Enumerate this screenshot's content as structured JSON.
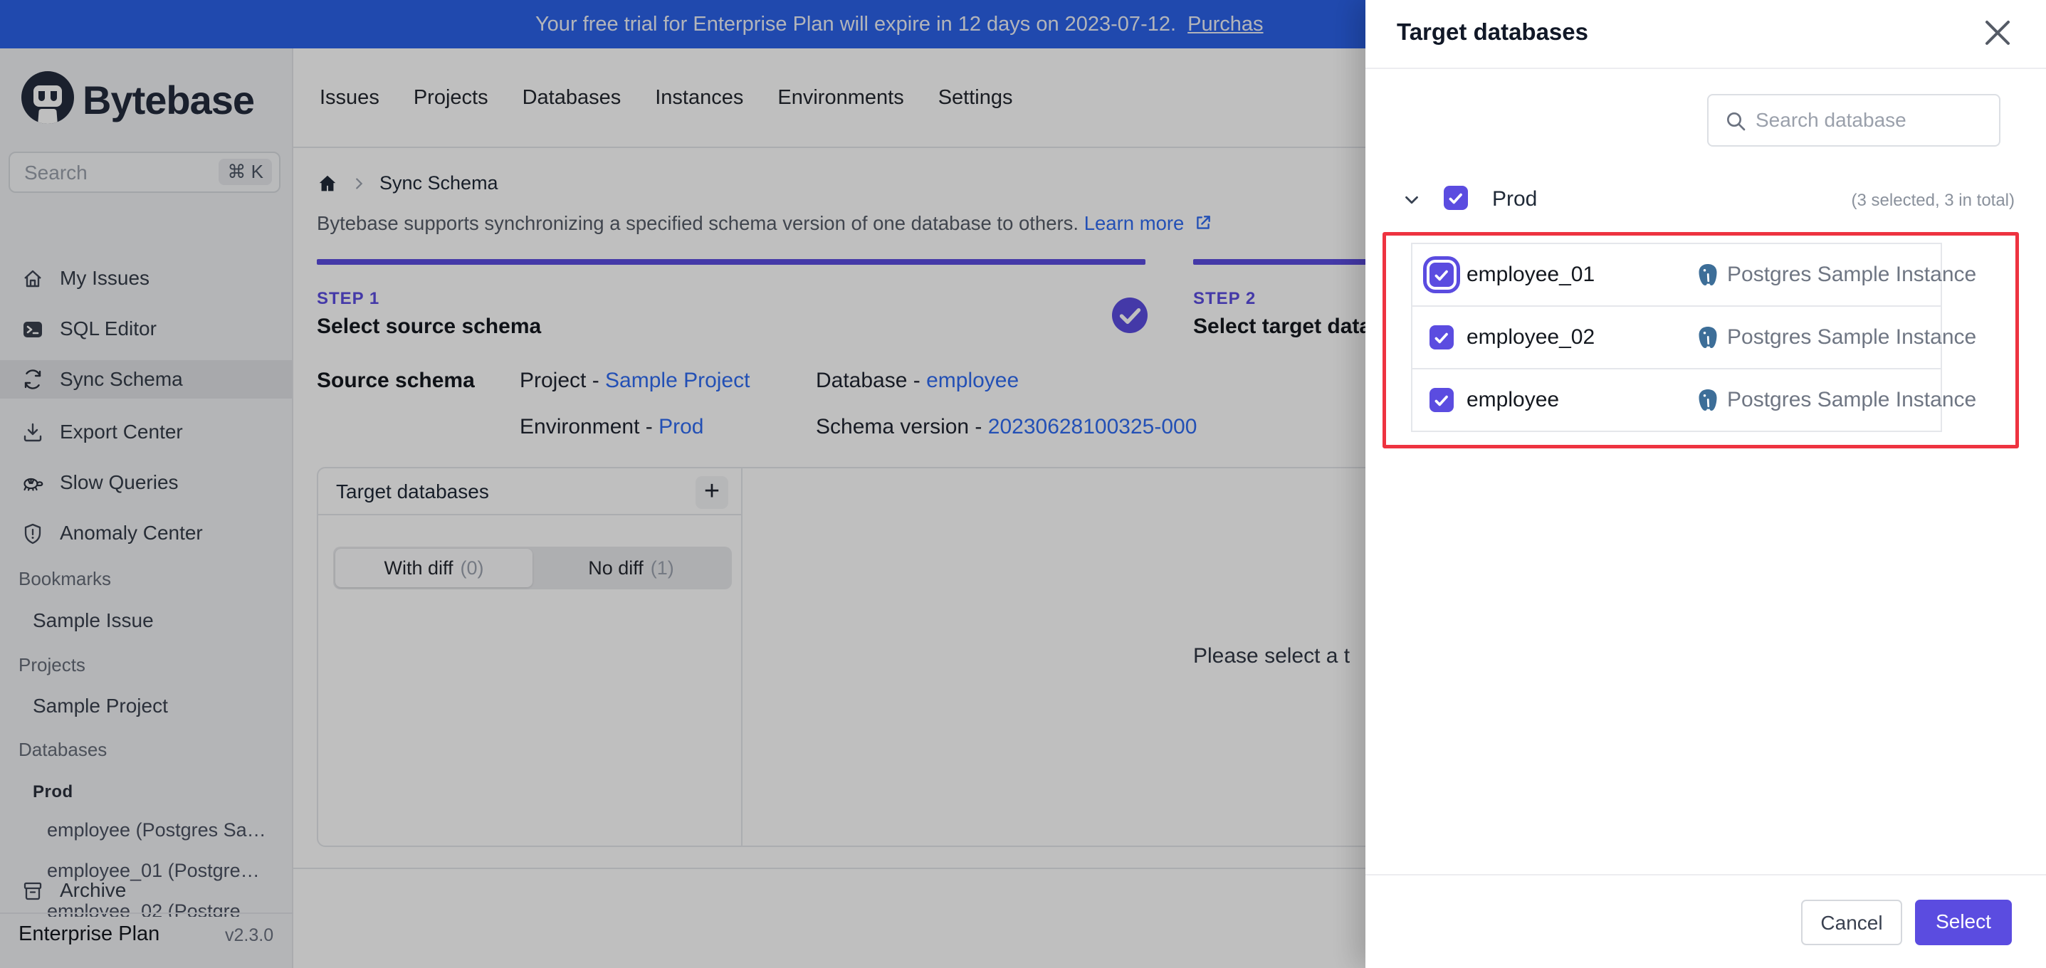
{
  "banner": {
    "text": "Your free trial for Enterprise Plan will expire in 12 days on 2023-07-12.",
    "link_text": "Purchas"
  },
  "topnav": {
    "items": [
      "Issues",
      "Projects",
      "Databases",
      "Instances",
      "Environments",
      "Settings"
    ]
  },
  "sidebar": {
    "logo_text": "Bytebase",
    "search": {
      "placeholder": "Search",
      "shortcut": "⌘ K"
    },
    "nav": [
      {
        "label": "My Issues",
        "icon": "home-icon"
      },
      {
        "label": "SQL Editor",
        "icon": "terminal-icon"
      },
      {
        "label": "Sync Schema",
        "icon": "sync-icon",
        "active": true
      },
      {
        "label": "Export Center",
        "icon": "download-icon"
      },
      {
        "label": "Slow Queries",
        "icon": "turtle-icon"
      },
      {
        "label": "Anomaly Center",
        "icon": "shield-icon"
      }
    ],
    "sections": {
      "bookmarks_header": "Bookmarks",
      "bookmark_item": "Sample Issue",
      "projects_header": "Projects",
      "project_item": "Sample Project",
      "databases_header": "Databases",
      "environment": "Prod",
      "db_items": [
        "employee (Postgres Sa…",
        "employee_01 (Postgre…",
        "employee_02 (Postgre"
      ]
    },
    "archive": "Archive",
    "footer": {
      "plan": "Enterprise Plan",
      "version": "v2.3.0"
    }
  },
  "main": {
    "breadcrumb": "Sync Schema",
    "description": "Bytebase supports synchronizing a specified schema version of one database to others.",
    "learn_more": "Learn more",
    "steps": [
      {
        "label": "STEP 1",
        "title": "Select source schema"
      },
      {
        "label": "STEP 2",
        "title": "Select target datab"
      }
    ],
    "source": {
      "heading": "Source schema",
      "project_label": "Project - ",
      "project": "Sample Project",
      "database_label": "Database - ",
      "database": "employee",
      "environment_label": "Environment - ",
      "environment": "Prod",
      "schema_version_label": "Schema version - ",
      "schema_version": "20230628100325-000"
    },
    "panel": {
      "title": "Target databases",
      "add_label": "+",
      "tabs": [
        {
          "label": "With diff",
          "count": "(0)"
        },
        {
          "label": "No diff",
          "count": "(1)"
        }
      ],
      "empty_text": "Please select a t"
    }
  },
  "drawer": {
    "title": "Target databases",
    "search_placeholder": "Search database",
    "group": {
      "name": "Prod",
      "summary": "(3 selected, 3 in total)"
    },
    "rows": [
      {
        "name": "employee_01",
        "instance": "Postgres Sample Instance"
      },
      {
        "name": "employee_02",
        "instance": "Postgres Sample Instance"
      },
      {
        "name": "employee",
        "instance": "Postgres Sample Instance"
      }
    ],
    "cancel_label": "Cancel",
    "select_label": "Select"
  },
  "colors": {
    "accent_indigo": "#5b4ce0",
    "link_blue": "#2f6bf2",
    "banner_blue": "#2b62e9",
    "highlight_red": "#ee3340",
    "postgres_blue": "#3d6e98"
  }
}
